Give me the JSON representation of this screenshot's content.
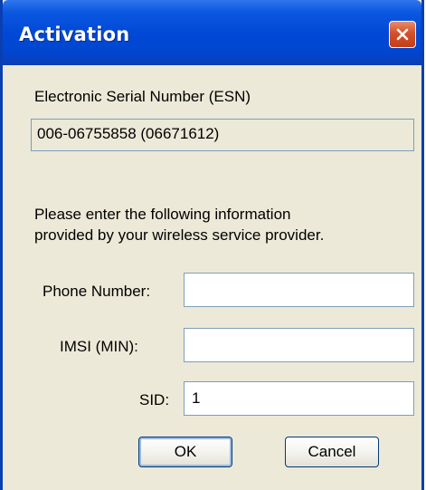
{
  "window": {
    "title": "Activation",
    "close_glyph": "✕"
  },
  "esn": {
    "label": "Electronic Serial Number (ESN)",
    "value": "006-06755858 (06671612)"
  },
  "instructions": {
    "line1": "Please enter the following information",
    "line2": "provided by your wireless service provider."
  },
  "fields": {
    "phone": {
      "label": "Phone Number:",
      "value": ""
    },
    "imsi": {
      "label": "IMSI (MIN):",
      "value": ""
    },
    "sid": {
      "label": "SID:",
      "value": "1"
    }
  },
  "buttons": {
    "ok": "OK",
    "cancel": "Cancel"
  },
  "colors": {
    "title_bar": "#0049d6",
    "close_button": "#d4502a",
    "dialog_background": "#ece9d8",
    "field_border": "#7f9db9"
  },
  "icons": {
    "close": "close-icon"
  }
}
